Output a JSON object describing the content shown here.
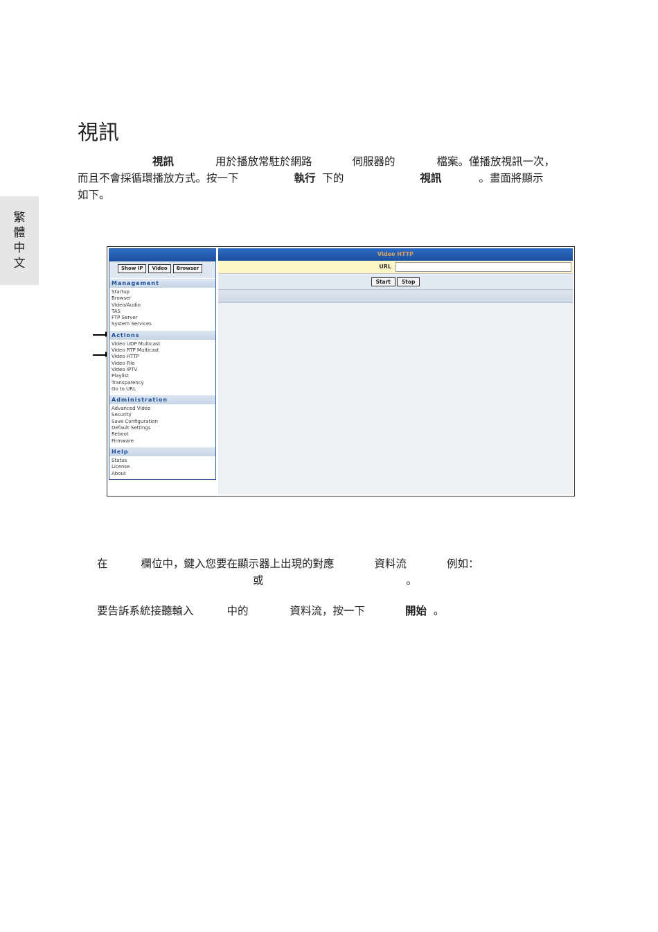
{
  "side_tab": [
    "繁",
    "體",
    "中",
    "文"
  ],
  "heading": "視訊",
  "intro": {
    "line1": {
      "b1": "視訊",
      "t1": "用於播放常駐於網路",
      "t2": "伺服器的",
      "t3": "檔案。僅播放視訊一次，"
    },
    "line2": {
      "t1": "而且不會採循環播放方式。按一下",
      "b1": "執行",
      "t2": "下的",
      "b2": "視訊",
      "t3": "。畫面將顯示"
    },
    "line3": "如下。"
  },
  "screenshot": {
    "buttons": [
      "Show IP",
      "Video",
      "Browser"
    ],
    "sections": [
      {
        "title": "Management",
        "items": [
          "Startup",
          "Browser",
          "Video/Audio",
          "TAS",
          "FTP Server",
          "System Services"
        ]
      },
      {
        "title": "Actions",
        "items": [
          "Video UDP Multicast",
          "Video RTP Multicast",
          "Video HTTP",
          "Video File",
          "Video IPTV",
          "Playlist",
          "Transparency",
          "Go to URL"
        ]
      },
      {
        "title": "Administration",
        "items": [
          "Advanced Video",
          "Security",
          "Save Configuration",
          "Default Settings",
          "Reboot",
          "Firmware"
        ]
      },
      {
        "title": "Help",
        "items": [
          "Status",
          "License",
          "About"
        ]
      }
    ],
    "panel_title": "Video HTTP",
    "url_label": "URL",
    "start_label": "Start",
    "stop_label": "Stop"
  },
  "step1": {
    "t1": "在",
    "t2": "欄位中，鍵入您要在顯示器上出現的對應",
    "t3": "資料流",
    "t4": "例如：",
    "t5": "或",
    "t6": "。"
  },
  "step2": {
    "t1": "要告訴系統接聽輸入",
    "t2": "中的",
    "t3": "資料流，按一下",
    "b1": "開始",
    "t4": "。"
  }
}
